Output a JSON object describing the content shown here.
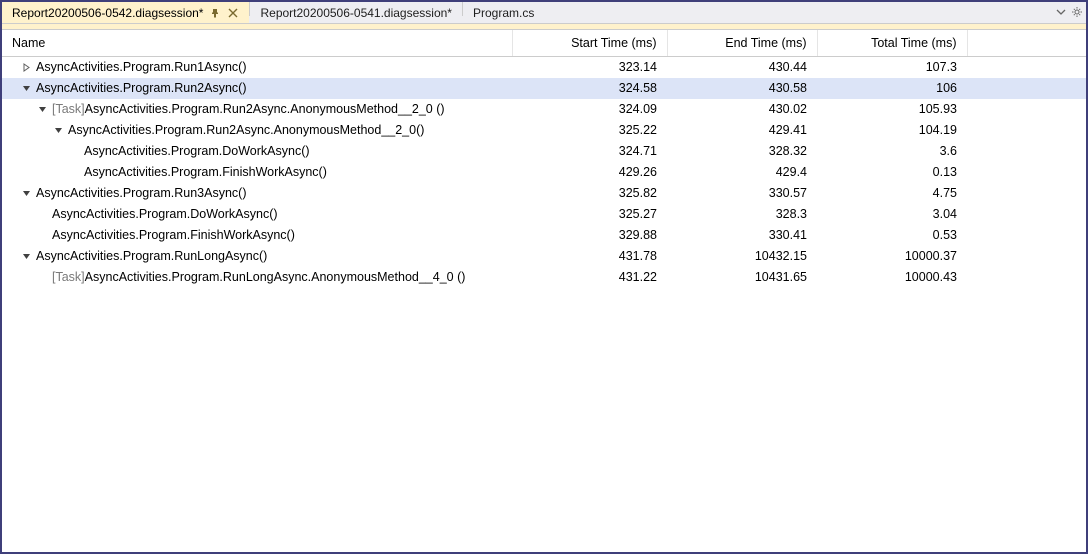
{
  "tabs": [
    {
      "label": "Report20200506-0542.diagsession*",
      "active": true
    },
    {
      "label": "Report20200506-0541.diagsession*",
      "active": false
    },
    {
      "label": "Program.cs",
      "active": false
    }
  ],
  "columns": {
    "name": "Name",
    "start": "Start Time (ms)",
    "end": "End Time (ms)",
    "total": "Total Time (ms)"
  },
  "rows": [
    {
      "indent": 0,
      "exp": "collapsed",
      "prefix": "",
      "name": "AsyncActivities.Program.Run1Async()",
      "start": "323.14",
      "end": "430.44",
      "total": "107.3",
      "selected": false
    },
    {
      "indent": 0,
      "exp": "expanded",
      "prefix": "",
      "name": "AsyncActivities.Program.Run2Async()",
      "start": "324.58",
      "end": "430.58",
      "total": "106",
      "selected": true
    },
    {
      "indent": 1,
      "exp": "expanded",
      "prefix": "[Task] ",
      "name": "AsyncActivities.Program.Run2Async.AnonymousMethod__2_0 ()",
      "start": "324.09",
      "end": "430.02",
      "total": "105.93",
      "selected": false
    },
    {
      "indent": 2,
      "exp": "expanded",
      "prefix": "",
      "name": "AsyncActivities.Program.Run2Async.AnonymousMethod__2_0()",
      "start": "325.22",
      "end": "429.41",
      "total": "104.19",
      "selected": false
    },
    {
      "indent": 3,
      "exp": "none",
      "prefix": "",
      "name": "AsyncActivities.Program.DoWorkAsync()",
      "start": "324.71",
      "end": "328.32",
      "total": "3.6",
      "selected": false
    },
    {
      "indent": 3,
      "exp": "none",
      "prefix": "",
      "name": "AsyncActivities.Program.FinishWorkAsync()",
      "start": "429.26",
      "end": "429.4",
      "total": "0.13",
      "selected": false
    },
    {
      "indent": 0,
      "exp": "expanded",
      "prefix": "",
      "name": "AsyncActivities.Program.Run3Async()",
      "start": "325.82",
      "end": "330.57",
      "total": "4.75",
      "selected": false
    },
    {
      "indent": 1,
      "exp": "none",
      "prefix": "",
      "name": "AsyncActivities.Program.DoWorkAsync()",
      "start": "325.27",
      "end": "328.3",
      "total": "3.04",
      "selected": false
    },
    {
      "indent": 1,
      "exp": "none",
      "prefix": "",
      "name": "AsyncActivities.Program.FinishWorkAsync()",
      "start": "329.88",
      "end": "330.41",
      "total": "0.53",
      "selected": false
    },
    {
      "indent": 0,
      "exp": "expanded",
      "prefix": "",
      "name": "AsyncActivities.Program.RunLongAsync()",
      "start": "431.78",
      "end": "10432.15",
      "total": "10000.37",
      "selected": false
    },
    {
      "indent": 1,
      "exp": "none",
      "prefix": "[Task] ",
      "name": "AsyncActivities.Program.RunLongAsync.AnonymousMethod__4_0 ()",
      "start": "431.22",
      "end": "10431.65",
      "total": "10000.43",
      "selected": false
    }
  ]
}
